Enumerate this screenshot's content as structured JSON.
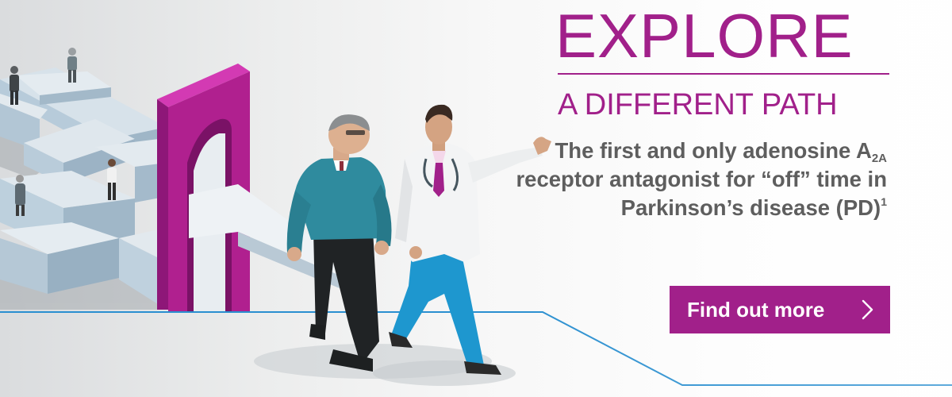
{
  "headline": {
    "line1": "EXPLORE",
    "line2": "A DIFFERENT PATH"
  },
  "description": {
    "part1": "The first and only adenosine A",
    "subscript": "2A",
    "part2": " receptor antagonist for “off” time in Parkinson’s disease (PD)",
    "superscript": "1"
  },
  "cta": {
    "label": "Find out more",
    "icon": "chevron-right-icon"
  },
  "colors": {
    "brand_magenta": "#a1208a",
    "text_gray": "#5e5e5e",
    "line_blue": "#2a8fd0"
  }
}
